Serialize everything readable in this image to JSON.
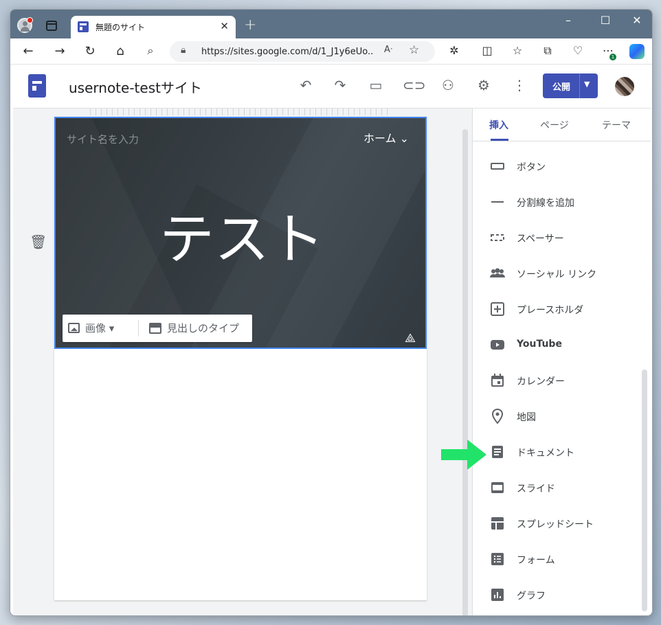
{
  "browser": {
    "tab_title": "無題のサイト",
    "tab_close": "✕",
    "new_tab": "+",
    "url": "https://sites.google.com/d/1_J1y6eUo...",
    "window_controls": [
      "–",
      "☐",
      "✕"
    ]
  },
  "header": {
    "site_name": "usernote-testサイト",
    "publish_label": "公開"
  },
  "hero": {
    "site_title_placeholder": "サイト名を入力",
    "nav_label": "ホーム ⌄",
    "title": "テスト",
    "toolbar": {
      "image_label": "画像 ▾",
      "header_type_label": "見出しのタイプ"
    }
  },
  "panel": {
    "tabs": [
      {
        "label": "挿入",
        "active": true
      },
      {
        "label": "ページ",
        "active": false
      },
      {
        "label": "テーマ",
        "active": false
      }
    ],
    "items": [
      {
        "label": "ボタン",
        "icon": "button-icon"
      },
      {
        "label": "分割線を追加",
        "icon": "divider-icon"
      },
      {
        "label": "スペーサー",
        "icon": "spacer-icon"
      },
      {
        "label": "ソーシャル リンク",
        "icon": "social-links-icon"
      },
      {
        "label": "プレースホルダ",
        "icon": "placeholder-icon"
      },
      {
        "label": "YouTube",
        "icon": "youtube-icon"
      },
      {
        "label": "カレンダー",
        "icon": "calendar-icon"
      },
      {
        "label": "地図",
        "icon": "map-icon"
      },
      {
        "label": "ドキュメント",
        "icon": "docs-icon"
      },
      {
        "label": "スライド",
        "icon": "slides-icon"
      },
      {
        "label": "スプレッドシート",
        "icon": "sheets-icon"
      },
      {
        "label": "フォーム",
        "icon": "forms-icon"
      },
      {
        "label": "グラフ",
        "icon": "chart-icon"
      }
    ]
  },
  "colors": {
    "brand": "#3f51b5",
    "hero_bg": "#363d42",
    "selection": "#4285f4",
    "annotation_arrow": "#22e36a"
  }
}
